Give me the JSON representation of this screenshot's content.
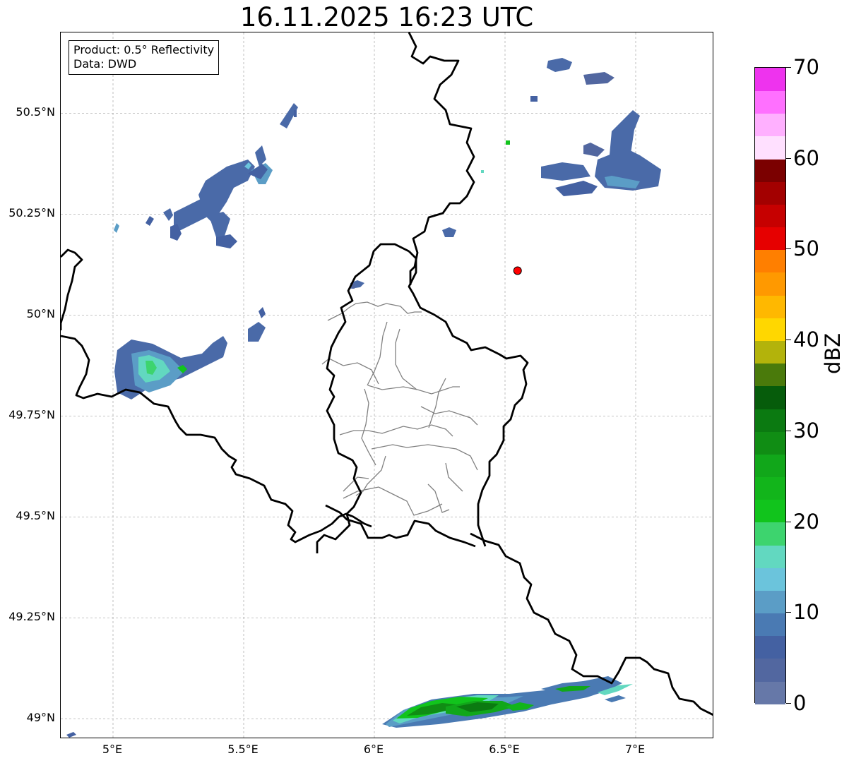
{
  "title": "16.11.2025 16:23 UTC",
  "info_box": {
    "product": "Product: 0.5° Reflectivity",
    "data": "Data: DWD"
  },
  "map": {
    "lon_range": [
      4.8,
      7.3
    ],
    "lat_range": [
      48.95,
      50.7
    ],
    "lat_ticks": [
      {
        "value": 50.5,
        "label": "50.5°N"
      },
      {
        "value": 50.25,
        "label": "50.25°N"
      },
      {
        "value": 50.0,
        "label": "50°N"
      },
      {
        "value": 49.75,
        "label": "49.75°N"
      },
      {
        "value": 49.5,
        "label": "49.5°N"
      },
      {
        "value": 49.25,
        "label": "49.25°N"
      },
      {
        "value": 49.0,
        "label": "49°N"
      }
    ],
    "lon_ticks": [
      {
        "value": 5.0,
        "label": "5°E"
      },
      {
        "value": 5.5,
        "label": "5.5°E"
      },
      {
        "value": 6.0,
        "label": "6°E"
      },
      {
        "value": 6.5,
        "label": "6.5°E"
      },
      {
        "value": 7.0,
        "label": "7°E"
      }
    ],
    "radar_site": {
      "lon": 6.548,
      "lat": 50.11,
      "color": "#ff0000"
    },
    "grid_color": "#b0b0b0",
    "border_color": "#000000",
    "district_color": "#808080"
  },
  "colorbar": {
    "unit": "dBZ",
    "min": 0,
    "max": 70,
    "ticks": [
      "0",
      "10",
      "20",
      "30",
      "40",
      "50",
      "60",
      "70"
    ],
    "colors": [
      "#6678a8",
      "#5267a0",
      "#4461a2",
      "#4a7ab3",
      "#5b9dc6",
      "#6bc4dc",
      "#62d8c0",
      "#3dd46e",
      "#11c41c",
      "#12b51b",
      "#11a71a",
      "#108d14",
      "#0b7a11",
      "#065c0b",
      "#4a7a0b",
      "#b3b30b",
      "#ffd700",
      "#ffb800",
      "#ff9900",
      "#ff7f00",
      "#e60000",
      "#c60000",
      "#a30000",
      "#7b0000",
      "#ffe0ff",
      "#ffb0ff",
      "#ff70ff",
      "#ee33ee"
    ]
  }
}
